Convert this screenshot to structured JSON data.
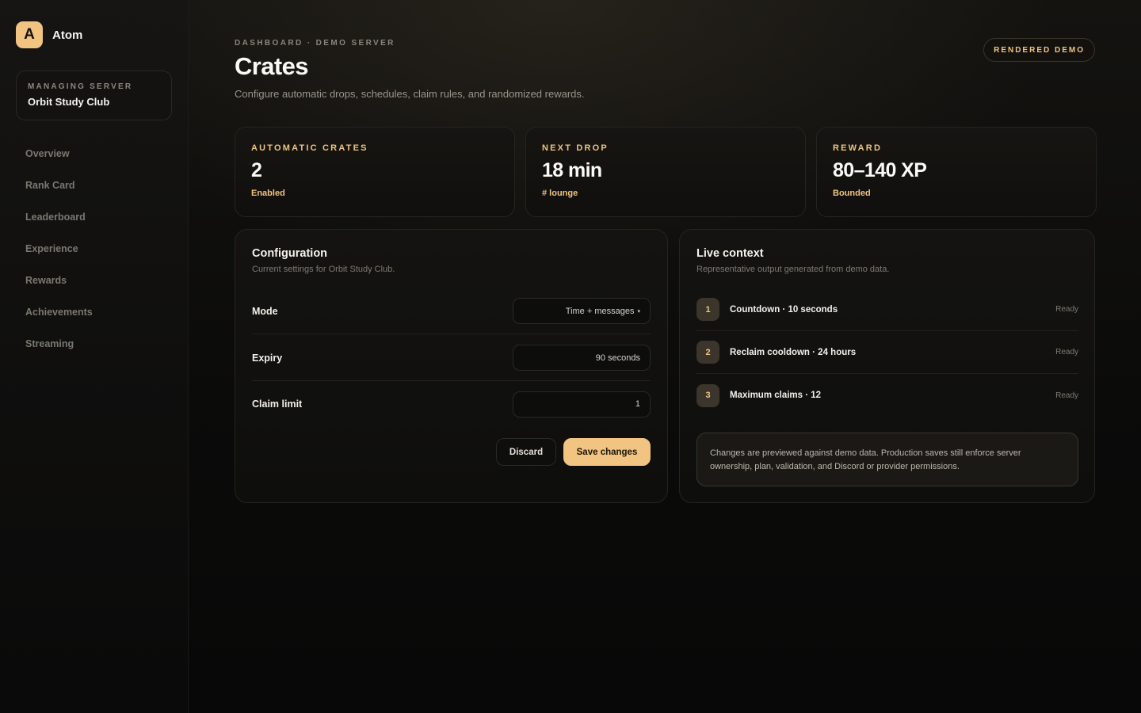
{
  "brand": {
    "logo_letter": "A",
    "name": "Atom"
  },
  "server": {
    "kicker": "MANAGING SERVER",
    "name": "Orbit Study Club"
  },
  "nav": [
    "Overview",
    "Rank Card",
    "Leaderboard",
    "Experience",
    "Rewards",
    "Achievements",
    "Streaming"
  ],
  "header": {
    "breadcrumb": "DASHBOARD · DEMO SERVER",
    "title": "Crates",
    "subtitle": "Configure automatic drops, schedules, claim rules, and randomized rewards.",
    "badge": "RENDERED DEMO"
  },
  "stats": [
    {
      "label": "AUTOMATIC CRATES",
      "value": "2",
      "meta": "Enabled"
    },
    {
      "label": "NEXT DROP",
      "value": "18 min",
      "meta": "# lounge"
    },
    {
      "label": "REWARD",
      "value": "80–140 XP",
      "meta": "Bounded"
    }
  ],
  "config": {
    "title": "Configuration",
    "subtitle": "Current settings for Orbit Study Club.",
    "fields": [
      {
        "label": "Mode",
        "value": "Time + messages",
        "caret": "▾"
      },
      {
        "label": "Expiry",
        "value": "90 seconds"
      },
      {
        "label": "Claim limit",
        "value": "1"
      }
    ],
    "discard_label": "Discard",
    "save_label": "Save changes"
  },
  "live": {
    "title": "Live context",
    "subtitle": "Representative output generated from demo data.",
    "items": [
      {
        "num": "1",
        "text": "Countdown · 10 seconds",
        "status": "Ready"
      },
      {
        "num": "2",
        "text": "Reclaim cooldown · 24 hours",
        "status": "Ready"
      },
      {
        "num": "3",
        "text": "Maximum claims · 12",
        "status": "Ready"
      }
    ],
    "note": "Changes are previewed against demo data. Production saves still enforce server ownership, plan, validation, and Discord or provider permissions."
  },
  "colors": {
    "accent": "#f1c481",
    "background": "#0a0a0a",
    "card": "#141311"
  }
}
